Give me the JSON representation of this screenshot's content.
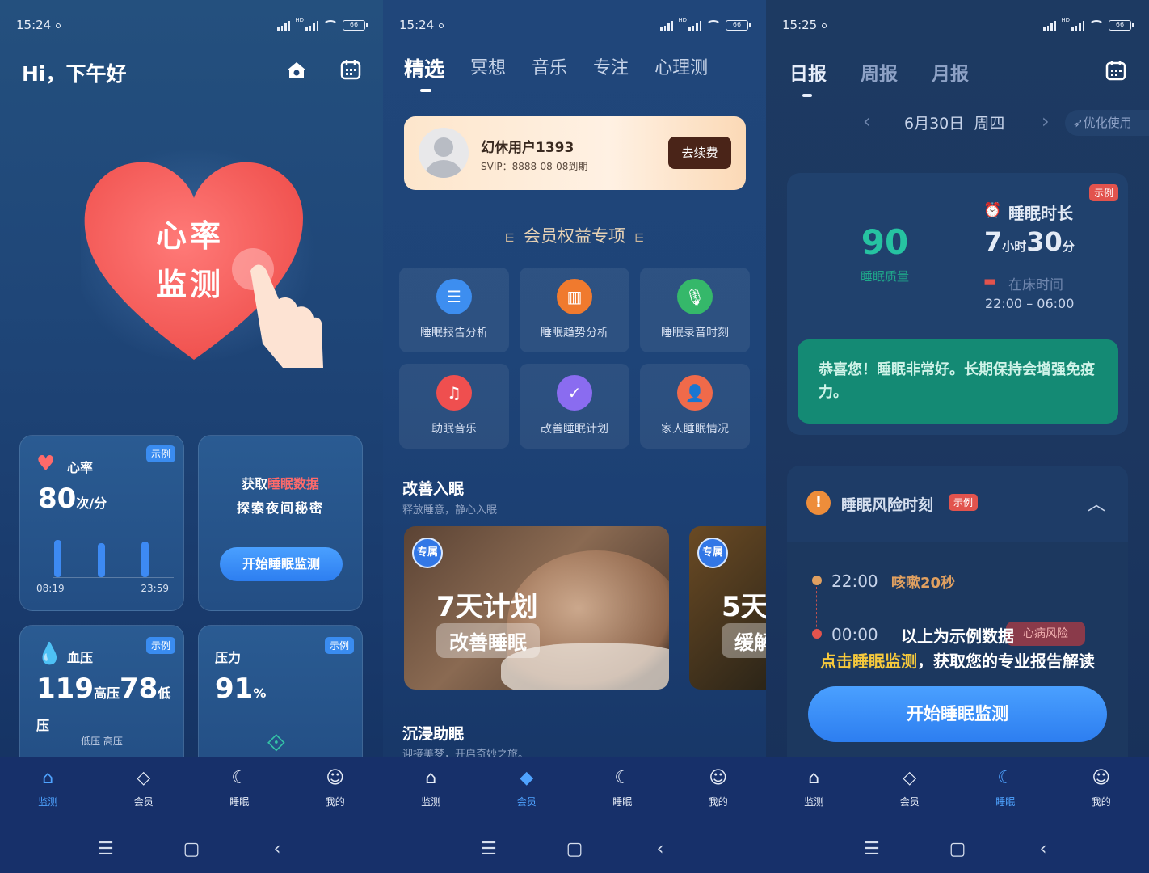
{
  "panels": [
    {
      "status": {
        "time": "15:24",
        "battery": "66"
      },
      "greeting": "Hi，下午好",
      "hero": {
        "line1": "心率",
        "line2": "监测"
      },
      "hr_card": {
        "label": "心率",
        "badge": "示例",
        "value": "80",
        "unit": "次/分",
        "t_start": "08:19",
        "t_end": "23:59"
      },
      "sleep_card": {
        "line1_pre": "获取",
        "line1_em": "睡眠数据",
        "line2": "探索夜间秘密",
        "button": "开始睡眠监测"
      },
      "bp_card": {
        "label": "血压",
        "badge": "示例",
        "high": "119",
        "high_unit": "高压",
        "low": "78",
        "low_unit": "低压",
        "legend": "低压 高压"
      },
      "stress_card": {
        "label": "压力",
        "badge": "示例",
        "value": "91",
        "unit": "%"
      }
    },
    {
      "status": {
        "time": "15:24",
        "battery": "66"
      },
      "tabs": [
        "精选",
        "冥想",
        "音乐",
        "专注",
        "心理测"
      ],
      "vip": {
        "name": "幻休用户1393",
        "expire": "SVIP：8888-08-08到期",
        "button": "去续费"
      },
      "benefits_title": "会员权益专项",
      "benefits": [
        "睡眠报告分析",
        "睡眠趋势分析",
        "睡眠录音时刻",
        "助眠音乐",
        "改善睡眠计划",
        "家人睡眠情况"
      ],
      "improve": {
        "title": "改善入眠",
        "subtitle": "释放睡意，静心入眠"
      },
      "promo1": {
        "tag": "专属",
        "title": "7天计划",
        "sub": "改善睡眠"
      },
      "promo2": {
        "tag": "专属",
        "title": "5天",
        "sub": "缓解"
      },
      "immerse": {
        "title": "沉浸助眠",
        "subtitle": "迎接美梦，开启奇妙之旅。"
      }
    },
    {
      "status": {
        "time": "15:25",
        "battery": "66"
      },
      "tabs": [
        "日报",
        "周报",
        "月报"
      ],
      "date": "6月30日  周四",
      "optimize": "优化使用",
      "score": {
        "value": "90",
        "label": "睡眠质量",
        "badge": "示例",
        "fraction": 0.9
      },
      "duration": {
        "label": "睡眠时长",
        "hours": "7",
        "h_unit": "小时",
        "minutes": "30",
        "m_unit": "分"
      },
      "inbed": {
        "label": "在床时间",
        "range": "22:00 – 06:00"
      },
      "message": "恭喜您！睡眠非常好。长期保持会增强免疫力。",
      "risk": {
        "title": "睡眠风险时刻",
        "badge": "示例",
        "item1_time": "22:00",
        "item1_text": "咳嗽20秒",
        "item2_time": "00:00",
        "item2_tag": "心病风险"
      },
      "overlay1": "以上为示例数据",
      "overlay2_em": "点击睡眠监测",
      "overlay2_rest": "，获取您的专业报告解读",
      "button": "开始睡眠监测"
    }
  ],
  "tabbar": [
    "监测",
    "会员",
    "睡眠",
    "我的"
  ]
}
